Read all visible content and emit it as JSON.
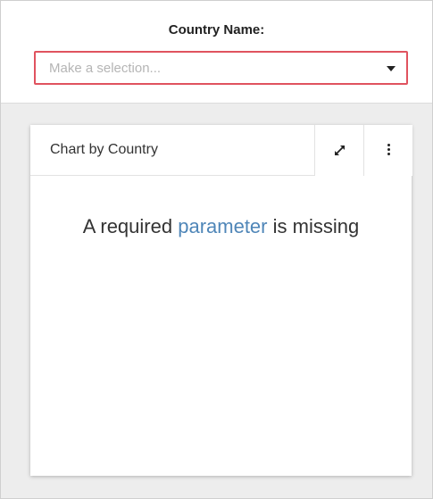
{
  "parameter": {
    "label": "Country Name:",
    "placeholder": "Make a selection...",
    "dropdown_icon": "caret-down-icon",
    "error_border_color": "#e0535f"
  },
  "card": {
    "title": "Chart by Country",
    "expand_icon": "expand-icon",
    "menu_icon": "more-vertical-icon",
    "message": {
      "prefix": "A required",
      "link": "parameter",
      "suffix": "is missing",
      "link_color": "#4f86b8"
    }
  }
}
